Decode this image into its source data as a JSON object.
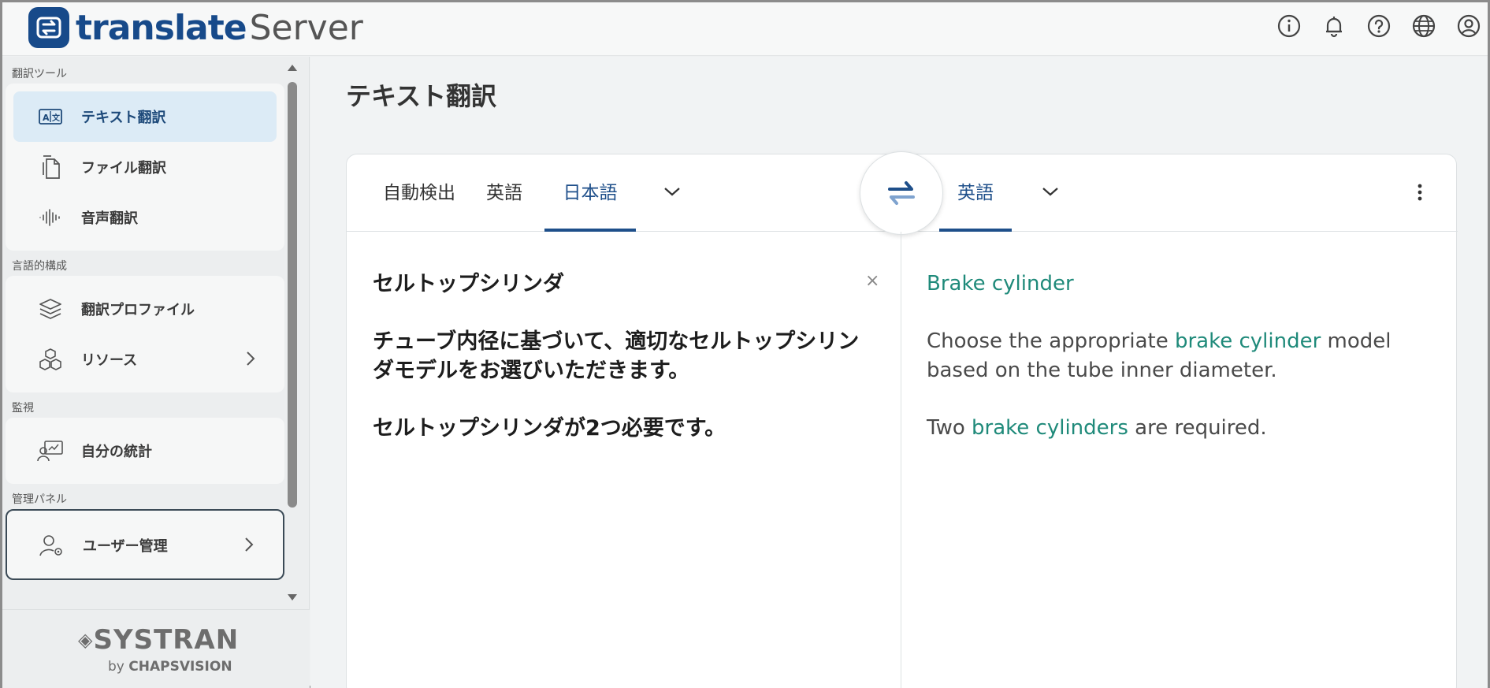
{
  "app": {
    "logo_word1": "translate",
    "logo_word2": "Server",
    "brand_color": "#174a8a"
  },
  "top_icons": [
    "info-icon",
    "bell-icon",
    "help-icon",
    "globe-icon",
    "user-icon"
  ],
  "sidebar": {
    "sections": [
      {
        "title": "翻訳ツール",
        "items": [
          {
            "label": "テキスト翻訳",
            "icon": "text-translate-icon",
            "active": true
          },
          {
            "label": "ファイル翻訳",
            "icon": "file-icon"
          },
          {
            "label": "音声翻訳",
            "icon": "audio-icon"
          }
        ]
      },
      {
        "title": "言語的構成",
        "items": [
          {
            "label": "翻訳プロファイル",
            "icon": "layers-icon"
          },
          {
            "label": "リソース",
            "icon": "cubes-icon",
            "has_chevron": true
          }
        ]
      },
      {
        "title": "監視",
        "items": [
          {
            "label": "自分の統計",
            "icon": "stats-icon"
          }
        ]
      },
      {
        "title": "管理パネル",
        "items": [
          {
            "label": "ユーザー管理",
            "icon": "user-gear-icon",
            "has_chevron": true
          }
        ]
      }
    ],
    "footer": {
      "brand": "SYSTRAN",
      "by": "by",
      "company": "CHAPSVISION"
    }
  },
  "main": {
    "title": "テキスト翻訳",
    "source_tabs": [
      "自動検出",
      "英語",
      "日本語"
    ],
    "source_active": "日本語",
    "target_tabs": [
      "英語"
    ],
    "target_active": "英語",
    "source_paragraphs": [
      "セルトップシリンダ",
      "チューブ内径に基づいて、適切なセルトップシリンダモデルをお選びいただきます。",
      "セルトップシリンダが2つ必要です。"
    ],
    "target": {
      "p1_hl": "Brake cylinder",
      "p2_a": "Choose the appropriate ",
      "p2_hl": "brake cylinder",
      "p2_b": " model based on the tube inner diameter.",
      "p3_a": "Two ",
      "p3_hl": "brake cylinders",
      "p3_b": " are required."
    },
    "clear_label": "×",
    "accent": "#1e4f8a",
    "highlight": "#1f8a7a"
  }
}
